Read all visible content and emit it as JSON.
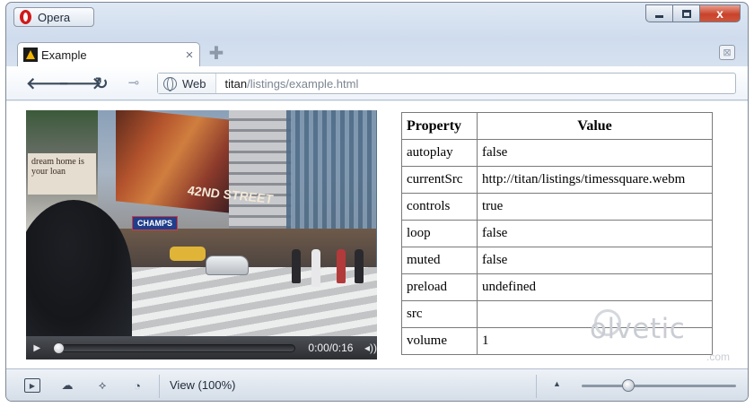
{
  "titlebar": {
    "app_name": "Opera",
    "minimize_icon": "minimize-icon",
    "maximize_icon": "maximize-icon",
    "close_glyph": "x"
  },
  "tabs": [
    {
      "title": "Example",
      "favicon": "warning-triangle-icon",
      "close_glyph": "×"
    }
  ],
  "new_tab_glyph": "✚",
  "trash_glyph": "⊠",
  "toolbar": {
    "back_glyph": "🡐",
    "forward_glyph": "🡒",
    "reload_glyph": "↻",
    "key_glyph": "⊸",
    "address_badge": "Web",
    "url_host": "titan",
    "url_path": "/listings/example.html"
  },
  "video": {
    "current_time": "0:00",
    "duration": "0:16",
    "time_display": "0:00/0:16",
    "progress": 0,
    "play_glyph": "▶",
    "volume_glyph": "◂))",
    "scene_sign_text": "dream home is your loan",
    "scene_billboard_text": "42ND STREET",
    "scene_store_text": "CHAMPS"
  },
  "properties_table": {
    "headers": [
      "Property",
      "Value"
    ],
    "rows": [
      {
        "property": "autoplay",
        "value": "false"
      },
      {
        "property": "currentSrc",
        "value": "http://titan/listings/timessquare.webm"
      },
      {
        "property": "controls",
        "value": "true"
      },
      {
        "property": "loop",
        "value": "false"
      },
      {
        "property": "muted",
        "value": "false"
      },
      {
        "property": "preload",
        "value": "undefined"
      },
      {
        "property": "src",
        "value": ""
      },
      {
        "property": "volume",
        "value": "1"
      }
    ]
  },
  "watermark": {
    "text": "olvetic",
    "suffix": ".com"
  },
  "statusbar": {
    "view_label": "View (100%)",
    "zoom_up_glyph": "▲",
    "zoom_level_fraction": 0.3
  },
  "colors": {
    "close_button": "#c9432b",
    "opera_red": "#d11a1a",
    "chrome_blue": "#cfdced"
  }
}
